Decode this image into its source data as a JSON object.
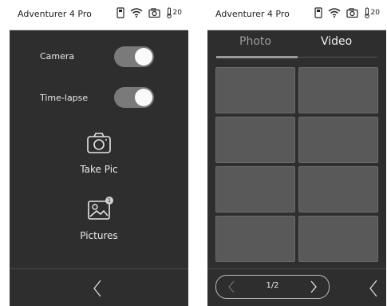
{
  "left": {
    "status": {
      "title": "Adventurer 4 Pro",
      "temp": "20"
    },
    "camera": {
      "label": "Camera",
      "on": true
    },
    "timelapse": {
      "label": "Time-lapse",
      "on": true
    },
    "take_pic": {
      "label": "Take Pic",
      "icon": "camera-icon"
    },
    "pictures": {
      "label": "Pictures",
      "icon": "image-icon",
      "badge": "1"
    },
    "back": {
      "icon": "chevron-left-icon"
    }
  },
  "right": {
    "status": {
      "title": "Adventurer 4 Pro",
      "temp": "20"
    },
    "tabs": {
      "photo": "Photo",
      "video": "Video"
    },
    "thumbnails": 8,
    "pager": {
      "text": "1/2"
    },
    "back": {
      "icon": "chevron-left-icon"
    }
  },
  "colors": {
    "panel": "#2e2e2e",
    "thumb": "#595959",
    "toggle_track": "#7a7a7a"
  }
}
